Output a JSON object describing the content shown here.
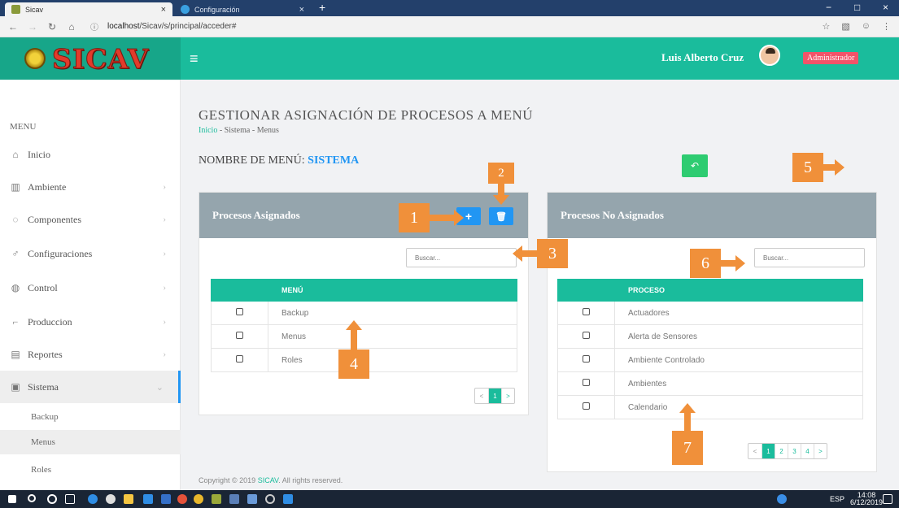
{
  "browser": {
    "tabs": [
      {
        "label": "Sicav",
        "close": "×"
      },
      {
        "label": "Configuración",
        "close": "×"
      }
    ],
    "new_tab": "+",
    "url_host": "localhost",
    "url_path": "/Sicav/s/principal/acceder#",
    "window_controls": [
      "−",
      "□",
      "×"
    ]
  },
  "header": {
    "brand": "SICAV",
    "menu_toggle": "≡",
    "user_name": "Luis Alberto Cruz",
    "role": "Administrador"
  },
  "sidebar": {
    "menu_label": "MENU",
    "items": [
      {
        "label": "Inicio",
        "icon": "home-icon",
        "glyph": "⌂",
        "chevron": ""
      },
      {
        "label": "Ambiente",
        "icon": "bank-icon",
        "glyph": "▥",
        "chevron": "›"
      },
      {
        "label": "Componentes",
        "icon": "puzzle-icon",
        "glyph": "◌",
        "chevron": "›"
      },
      {
        "label": "Configuraciones",
        "icon": "link-icon",
        "glyph": "♂",
        "chevron": "›"
      },
      {
        "label": "Control",
        "icon": "gauge-icon",
        "glyph": "◍",
        "chevron": "›"
      },
      {
        "label": "Produccion",
        "icon": "crop-icon",
        "glyph": "⌐",
        "chevron": "›"
      },
      {
        "label": "Reportes",
        "icon": "chart-icon",
        "glyph": "▤",
        "chevron": "›"
      },
      {
        "label": "Sistema",
        "icon": "window-icon",
        "glyph": "▣",
        "chevron": "⌄"
      }
    ],
    "sub_items": [
      "Backup",
      "Menus",
      "Roles"
    ]
  },
  "main": {
    "title": "GESTIONAR ASIGNACIÓN DE PROCESOS A MENÚ",
    "breadcrumb": {
      "home": "Inicio",
      "sep": " - ",
      "section": "Sistema",
      "page": "Menus"
    },
    "menu_name_label": "NOMBRE DE MENÚ:",
    "menu_name_value": "SISTEMA",
    "back_glyph": "↶",
    "assigned": {
      "title": "Procesos Asignados",
      "add_glyph": "+",
      "delete_glyph": "🗑",
      "search_placeholder": "Buscar...",
      "column": "MENÚ",
      "rows": [
        "Backup",
        "Menus",
        "Roles"
      ],
      "pager": [
        "<",
        "1",
        ">"
      ]
    },
    "unassigned": {
      "title": "Procesos No Asignados",
      "search_placeholder": "Buscar...",
      "column": "PROCESO",
      "rows": [
        "Actuadores",
        "Alerta de Sensores",
        "Ambiente Controlado",
        "Ambientes",
        "Calendario"
      ],
      "pager": [
        "<",
        "1",
        "2",
        "3",
        "4",
        ">"
      ]
    },
    "footer_prefix": "Copyright © 2019 ",
    "footer_link": "SICAV",
    "footer_suffix": ". All rights reserved."
  },
  "callouts": [
    "1",
    "2",
    "3",
    "4",
    "5",
    "6",
    "7"
  ],
  "taskbar": {
    "language": "ESP",
    "time": "14:08",
    "date": "6/12/2019"
  },
  "colors": {
    "accent": "#1abc9c",
    "primary": "#2196f3",
    "success": "#2ecc71",
    "danger": "#f25369",
    "callout": "#f0903a"
  }
}
